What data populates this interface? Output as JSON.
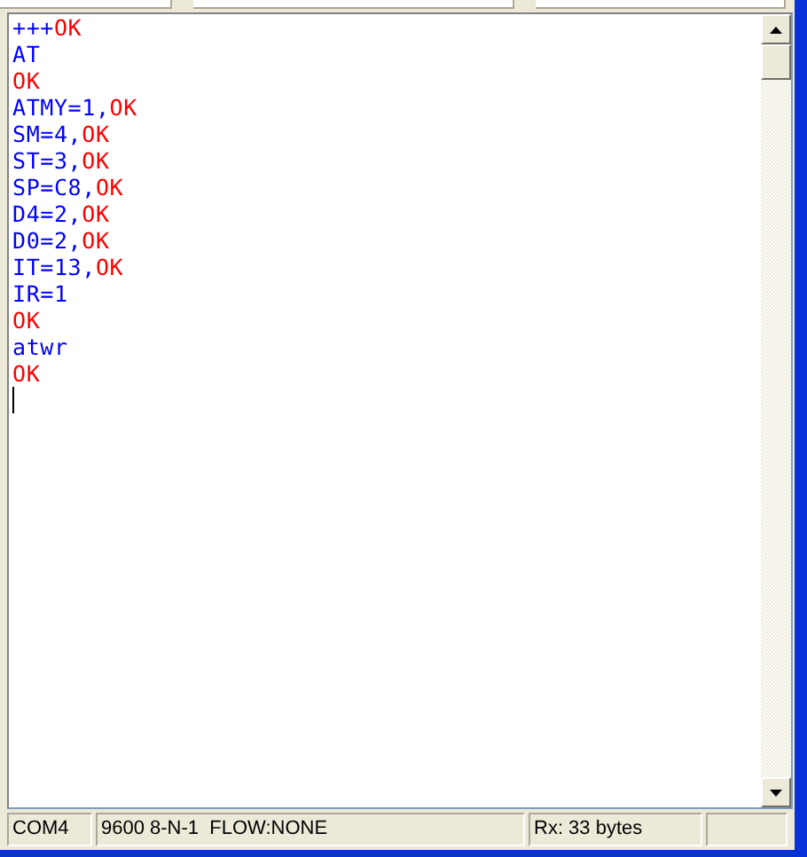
{
  "terminal": {
    "lines": [
      [
        {
          "kind": "sent",
          "text": "+++"
        },
        {
          "kind": "received",
          "text": "OK"
        }
      ],
      [
        {
          "kind": "sent",
          "text": "AT"
        }
      ],
      [
        {
          "kind": "received",
          "text": "OK"
        }
      ],
      [
        {
          "kind": "sent",
          "text": "ATMY=1,"
        },
        {
          "kind": "received",
          "text": "OK"
        }
      ],
      [
        {
          "kind": "sent",
          "text": "SM=4,"
        },
        {
          "kind": "received",
          "text": "OK"
        }
      ],
      [
        {
          "kind": "sent",
          "text": "ST=3,"
        },
        {
          "kind": "received",
          "text": "OK"
        }
      ],
      [
        {
          "kind": "sent",
          "text": "SP=C8,"
        },
        {
          "kind": "received",
          "text": "OK"
        }
      ],
      [
        {
          "kind": "sent",
          "text": "D4=2,"
        },
        {
          "kind": "received",
          "text": "OK"
        }
      ],
      [
        {
          "kind": "sent",
          "text": "D0=2,"
        },
        {
          "kind": "received",
          "text": "OK"
        }
      ],
      [
        {
          "kind": "sent",
          "text": "IT=13,"
        },
        {
          "kind": "received",
          "text": "OK"
        }
      ],
      [
        {
          "kind": "sent",
          "text": "IR=1"
        }
      ],
      [
        {
          "kind": "received",
          "text": "OK"
        }
      ],
      [
        {
          "kind": "sent",
          "text": "atwr"
        }
      ],
      [
        {
          "kind": "received",
          "text": "OK"
        }
      ]
    ]
  },
  "status_bar": {
    "port": "COM4",
    "settings": "9600 8-N-1  FLOW:NONE",
    "received": "Rx: 33 bytes"
  }
}
